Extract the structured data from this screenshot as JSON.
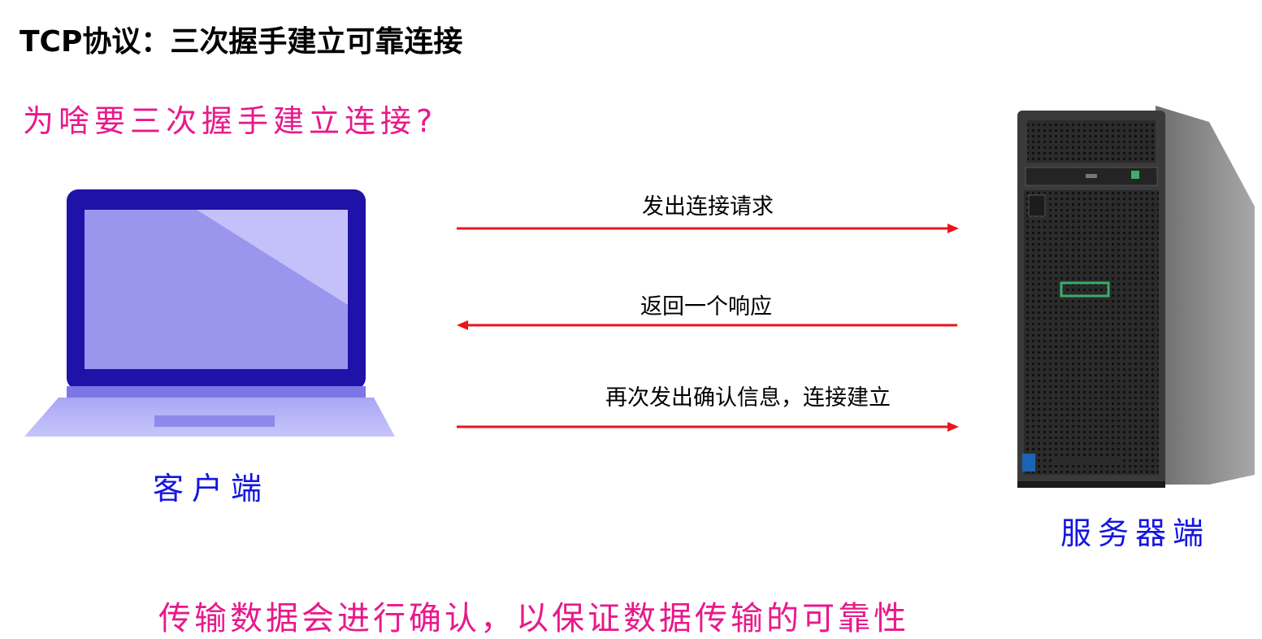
{
  "title": "TCP协议：三次握手建立可靠连接",
  "question": "为啥要三次握手建立连接?",
  "client": {
    "label": "客户端",
    "icon": "laptop-icon"
  },
  "server": {
    "label": "服务器端",
    "icon": "tower-server-icon"
  },
  "messages": [
    {
      "text": "发出连接请求",
      "direction": "client-to-server"
    },
    {
      "text": "返回一个响应",
      "direction": "server-to-client"
    },
    {
      "text": "再次发出确认信息，连接建立",
      "direction": "client-to-server"
    }
  ],
  "footer": "传输数据会进行确认，以保证数据传输的可靠性",
  "colors": {
    "arrow": "#e8161b",
    "handwriting_pink": "#e8198b",
    "handwriting_blue": "#1515e0",
    "laptop_frame": "#1e12a8",
    "laptop_screen": "#9a96ee",
    "laptop_base": "#b9b7f7",
    "server_body": "#3a3a3a",
    "server_accent": "#3cae6d"
  }
}
